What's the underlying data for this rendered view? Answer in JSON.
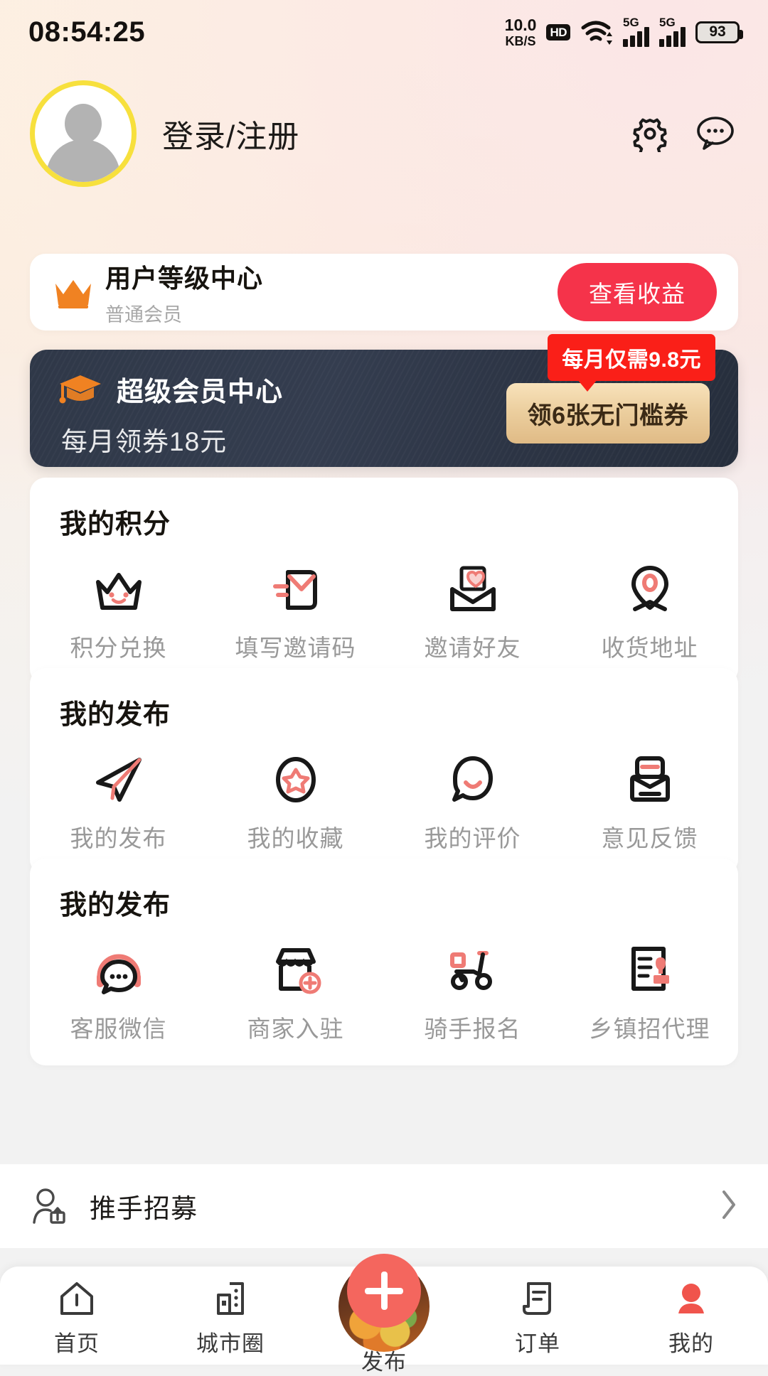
{
  "statusbar": {
    "time": "08:54:25",
    "net_speed_value": "10.0",
    "net_speed_unit": "KB/S",
    "hd_label": "HD",
    "signal1_label": "5G",
    "signal2_label": "5G",
    "battery_percent": "93"
  },
  "header": {
    "login_text": "登录/注册",
    "settings_icon": "gear-icon",
    "message_icon": "chat-bubble-dots-icon"
  },
  "level_card": {
    "icon": "crown-icon",
    "title": "用户等级中心",
    "subtitle": "普通会员",
    "button_label": "查看收益",
    "button_color": "#f5334a"
  },
  "vip_card": {
    "icon": "graduation-cap-icon",
    "title": "超级会员中心",
    "subtitle": "每月领券18元",
    "badge_label": "每月仅需9.8元",
    "badge_color": "#fa1f18",
    "button_label": "领6张无门槛券",
    "background_color": "#2f3848"
  },
  "sections": [
    {
      "title": "我的积分",
      "items": [
        {
          "label": "积分兑换",
          "icon": "crown-smile-icon"
        },
        {
          "label": "填写邀请码",
          "icon": "invite-code-icon"
        },
        {
          "label": "邀请好友",
          "icon": "envelope-heart-icon"
        },
        {
          "label": "收货地址",
          "icon": "location-pin-icon"
        }
      ]
    },
    {
      "title": "我的发布",
      "items": [
        {
          "label": "我的发布",
          "icon": "paper-plane-icon"
        },
        {
          "label": "我的收藏",
          "icon": "star-circle-icon"
        },
        {
          "label": "我的评价",
          "icon": "speech-smile-icon"
        },
        {
          "label": "意见反馈",
          "icon": "feedback-box-icon"
        }
      ]
    },
    {
      "title": "我的发布",
      "items": [
        {
          "label": "客服微信",
          "icon": "headset-chat-icon"
        },
        {
          "label": "商家入驻",
          "icon": "shop-plus-icon"
        },
        {
          "label": "骑手报名",
          "icon": "scooter-icon"
        },
        {
          "label": "乡镇招代理",
          "icon": "document-stamp-icon"
        }
      ]
    }
  ],
  "recruit_row": {
    "icon": "person-share-icon",
    "label": "推手招募",
    "chevron": "chevron-right-icon"
  },
  "tabbar": {
    "items": [
      {
        "label": "首页",
        "icon": "home-icon",
        "active": false
      },
      {
        "label": "城市圈",
        "icon": "buildings-icon",
        "active": false
      },
      {
        "label": "发布",
        "icon": "plus-circle-icon",
        "active": false
      },
      {
        "label": "订单",
        "icon": "receipt-icon",
        "active": false
      },
      {
        "label": "我的",
        "icon": "person-icon",
        "active": true
      }
    ],
    "active_color": "#f0544c"
  }
}
